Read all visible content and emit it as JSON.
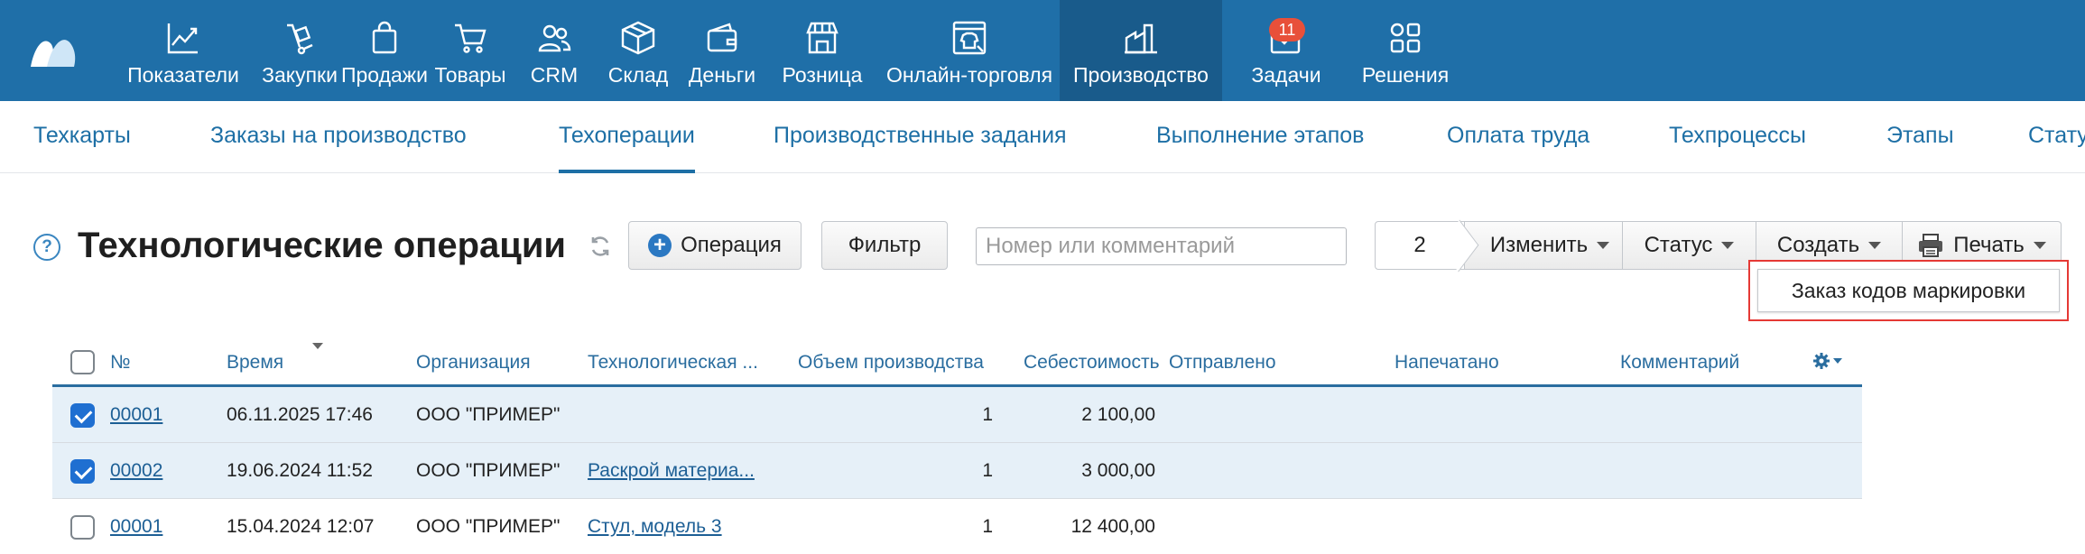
{
  "nav": {
    "items": [
      {
        "label": "Показатели",
        "icon": "chart-line-icon"
      },
      {
        "label": "Закупки",
        "icon": "cart-dolly-icon"
      },
      {
        "label": "Продажи",
        "icon": "shopping-bag-icon"
      },
      {
        "label": "Товары",
        "icon": "shopping-cart-icon"
      },
      {
        "label": "CRM",
        "icon": "users-icon"
      },
      {
        "label": "Склад",
        "icon": "box-icon"
      },
      {
        "label": "Деньги",
        "icon": "wallet-icon"
      },
      {
        "label": "Розница",
        "icon": "store-icon"
      },
      {
        "label": "Онлайн-торговля",
        "icon": "online-shop-icon"
      },
      {
        "label": "Производство",
        "icon": "factory-icon",
        "active": true
      },
      {
        "label": "Задачи",
        "icon": "tasks-check-icon",
        "badge": "11"
      },
      {
        "label": "Решения",
        "icon": "apps-grid-icon"
      }
    ]
  },
  "subnav": {
    "tabs": [
      {
        "label": "Техкарты"
      },
      {
        "label": "Заказы на производство"
      },
      {
        "label": "Техоперации",
        "active": true
      },
      {
        "label": "Производственные задания"
      },
      {
        "label": "Выполнение этапов"
      },
      {
        "label": "Оплата труда"
      },
      {
        "label": "Техпроцессы"
      },
      {
        "label": "Этапы"
      },
      {
        "label": "Стату"
      }
    ]
  },
  "page": {
    "title": "Технологические операции",
    "help": "?"
  },
  "toolbar": {
    "operation_label": "Операция",
    "filter_label": "Фильтр",
    "search_placeholder": "Номер или комментарий",
    "selected_count": "2",
    "change_label": "Изменить",
    "status_label": "Статус",
    "create_label": "Создать",
    "print_label": "Печать"
  },
  "dropdown": {
    "item_label": "Заказ кодов маркировки"
  },
  "table": {
    "headers": {
      "number": "№",
      "time": "Время",
      "organization": "Организация",
      "techcard": "Технологическая ...",
      "volume": "Объем производства",
      "cost": "Себестоимость",
      "sent": "Отправлено",
      "printed": "Напечатано",
      "comment": "Комментарий"
    },
    "rows": [
      {
        "checked": true,
        "number": "00001",
        "time": "06.11.2025 17:46",
        "organization": "ООО \"ПРИМЕР\"",
        "techcard": "",
        "volume": "1",
        "cost": "2 100,00"
      },
      {
        "checked": true,
        "number": "00002",
        "time": "19.06.2024 11:52",
        "organization": "ООО \"ПРИМЕР\"",
        "techcard": "Раскрой материа...",
        "volume": "1",
        "cost": "3 000,00"
      },
      {
        "checked": false,
        "number": "00001",
        "time": "15.04.2024 12:07",
        "organization": "ООО \"ПРИМЕР\"",
        "techcard": "Стул, модель 3",
        "volume": "1",
        "cost": "12 400,00"
      }
    ]
  },
  "colors": {
    "nav_bg": "#1f6fa8",
    "nav_active_bg": "#195b8b",
    "link": "#1d6fa5",
    "badge": "#e8503a",
    "selected_row": "#e6f0f8",
    "highlight_border": "#e53935"
  }
}
